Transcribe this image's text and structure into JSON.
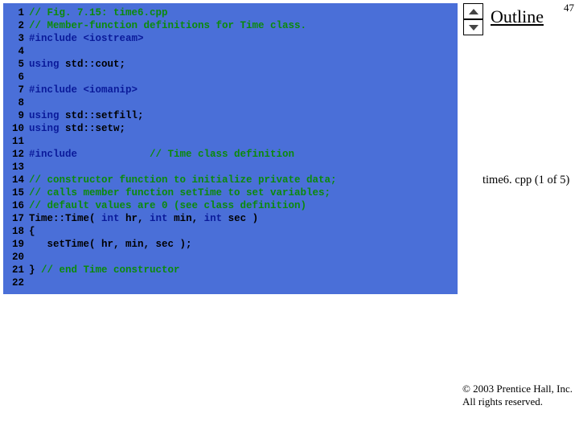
{
  "page_number": "47",
  "outline_label": "Outline",
  "file_caption": "time6. cpp (1 of 5)",
  "copyright_line1": "© 2003 Prentice Hall, Inc.",
  "copyright_line2": "All rights reserved.",
  "code": {
    "lines": [
      {
        "n": "1",
        "segs": [
          {
            "t": "// Fig. 7.15: time6.cpp",
            "c": "c-green"
          }
        ]
      },
      {
        "n": "2",
        "segs": [
          {
            "t": "// Member-function definitions for Time class.",
            "c": "c-green"
          }
        ]
      },
      {
        "n": "3",
        "segs": [
          {
            "t": "#include ",
            "c": "c-blue"
          },
          {
            "t": "<iostream>",
            "c": "c-blue"
          }
        ]
      },
      {
        "n": "4",
        "segs": [
          {
            "t": "",
            "c": "c-black"
          }
        ]
      },
      {
        "n": "5",
        "segs": [
          {
            "t": "using ",
            "c": "c-blue"
          },
          {
            "t": "std::cout;",
            "c": "c-black"
          }
        ]
      },
      {
        "n": "6",
        "segs": [
          {
            "t": "",
            "c": "c-black"
          }
        ]
      },
      {
        "n": "7",
        "segs": [
          {
            "t": "#include ",
            "c": "c-blue"
          },
          {
            "t": "<iomanip>",
            "c": "c-blue"
          }
        ]
      },
      {
        "n": "8",
        "segs": [
          {
            "t": "",
            "c": "c-black"
          }
        ]
      },
      {
        "n": "9",
        "segs": [
          {
            "t": "using ",
            "c": "c-blue"
          },
          {
            "t": "std::setfill;",
            "c": "c-black"
          }
        ]
      },
      {
        "n": "10",
        "segs": [
          {
            "t": "using ",
            "c": "c-blue"
          },
          {
            "t": "std::setw;",
            "c": "c-black"
          }
        ]
      },
      {
        "n": "11",
        "segs": [
          {
            "t": "",
            "c": "c-black"
          }
        ]
      },
      {
        "n": "12",
        "segs": [
          {
            "t": "#include",
            "c": "c-blue"
          },
          {
            "t": "            ",
            "c": "c-black"
          },
          {
            "t": "// Time class definition",
            "c": "c-green"
          }
        ]
      },
      {
        "n": "13",
        "segs": [
          {
            "t": "",
            "c": "c-black"
          }
        ]
      },
      {
        "n": "14",
        "segs": [
          {
            "t": "// constructor function to initialize private data;",
            "c": "c-green"
          }
        ]
      },
      {
        "n": "15",
        "segs": [
          {
            "t": "// calls member function setTime to set variables;",
            "c": "c-green"
          }
        ]
      },
      {
        "n": "16",
        "segs": [
          {
            "t": "// default values are 0 (see class definition)",
            "c": "c-green"
          }
        ]
      },
      {
        "n": "17",
        "segs": [
          {
            "t": "Time::Time( ",
            "c": "c-black"
          },
          {
            "t": "int",
            "c": "c-blue"
          },
          {
            "t": " hr, ",
            "c": "c-black"
          },
          {
            "t": "int",
            "c": "c-blue"
          },
          {
            "t": " min, ",
            "c": "c-black"
          },
          {
            "t": "int",
            "c": "c-blue"
          },
          {
            "t": " sec )",
            "c": "c-black"
          }
        ]
      },
      {
        "n": "18",
        "segs": [
          {
            "t": "{",
            "c": "c-black"
          }
        ]
      },
      {
        "n": "19",
        "segs": [
          {
            "t": "   setTime( hr, min, sec );",
            "c": "c-black"
          }
        ]
      },
      {
        "n": "20",
        "segs": [
          {
            "t": "",
            "c": "c-black"
          }
        ]
      },
      {
        "n": "21",
        "segs": [
          {
            "t": "} ",
            "c": "c-black"
          },
          {
            "t": "// end Time constructor",
            "c": "c-green"
          }
        ]
      },
      {
        "n": "22",
        "segs": [
          {
            "t": "",
            "c": "c-black"
          }
        ]
      }
    ]
  }
}
